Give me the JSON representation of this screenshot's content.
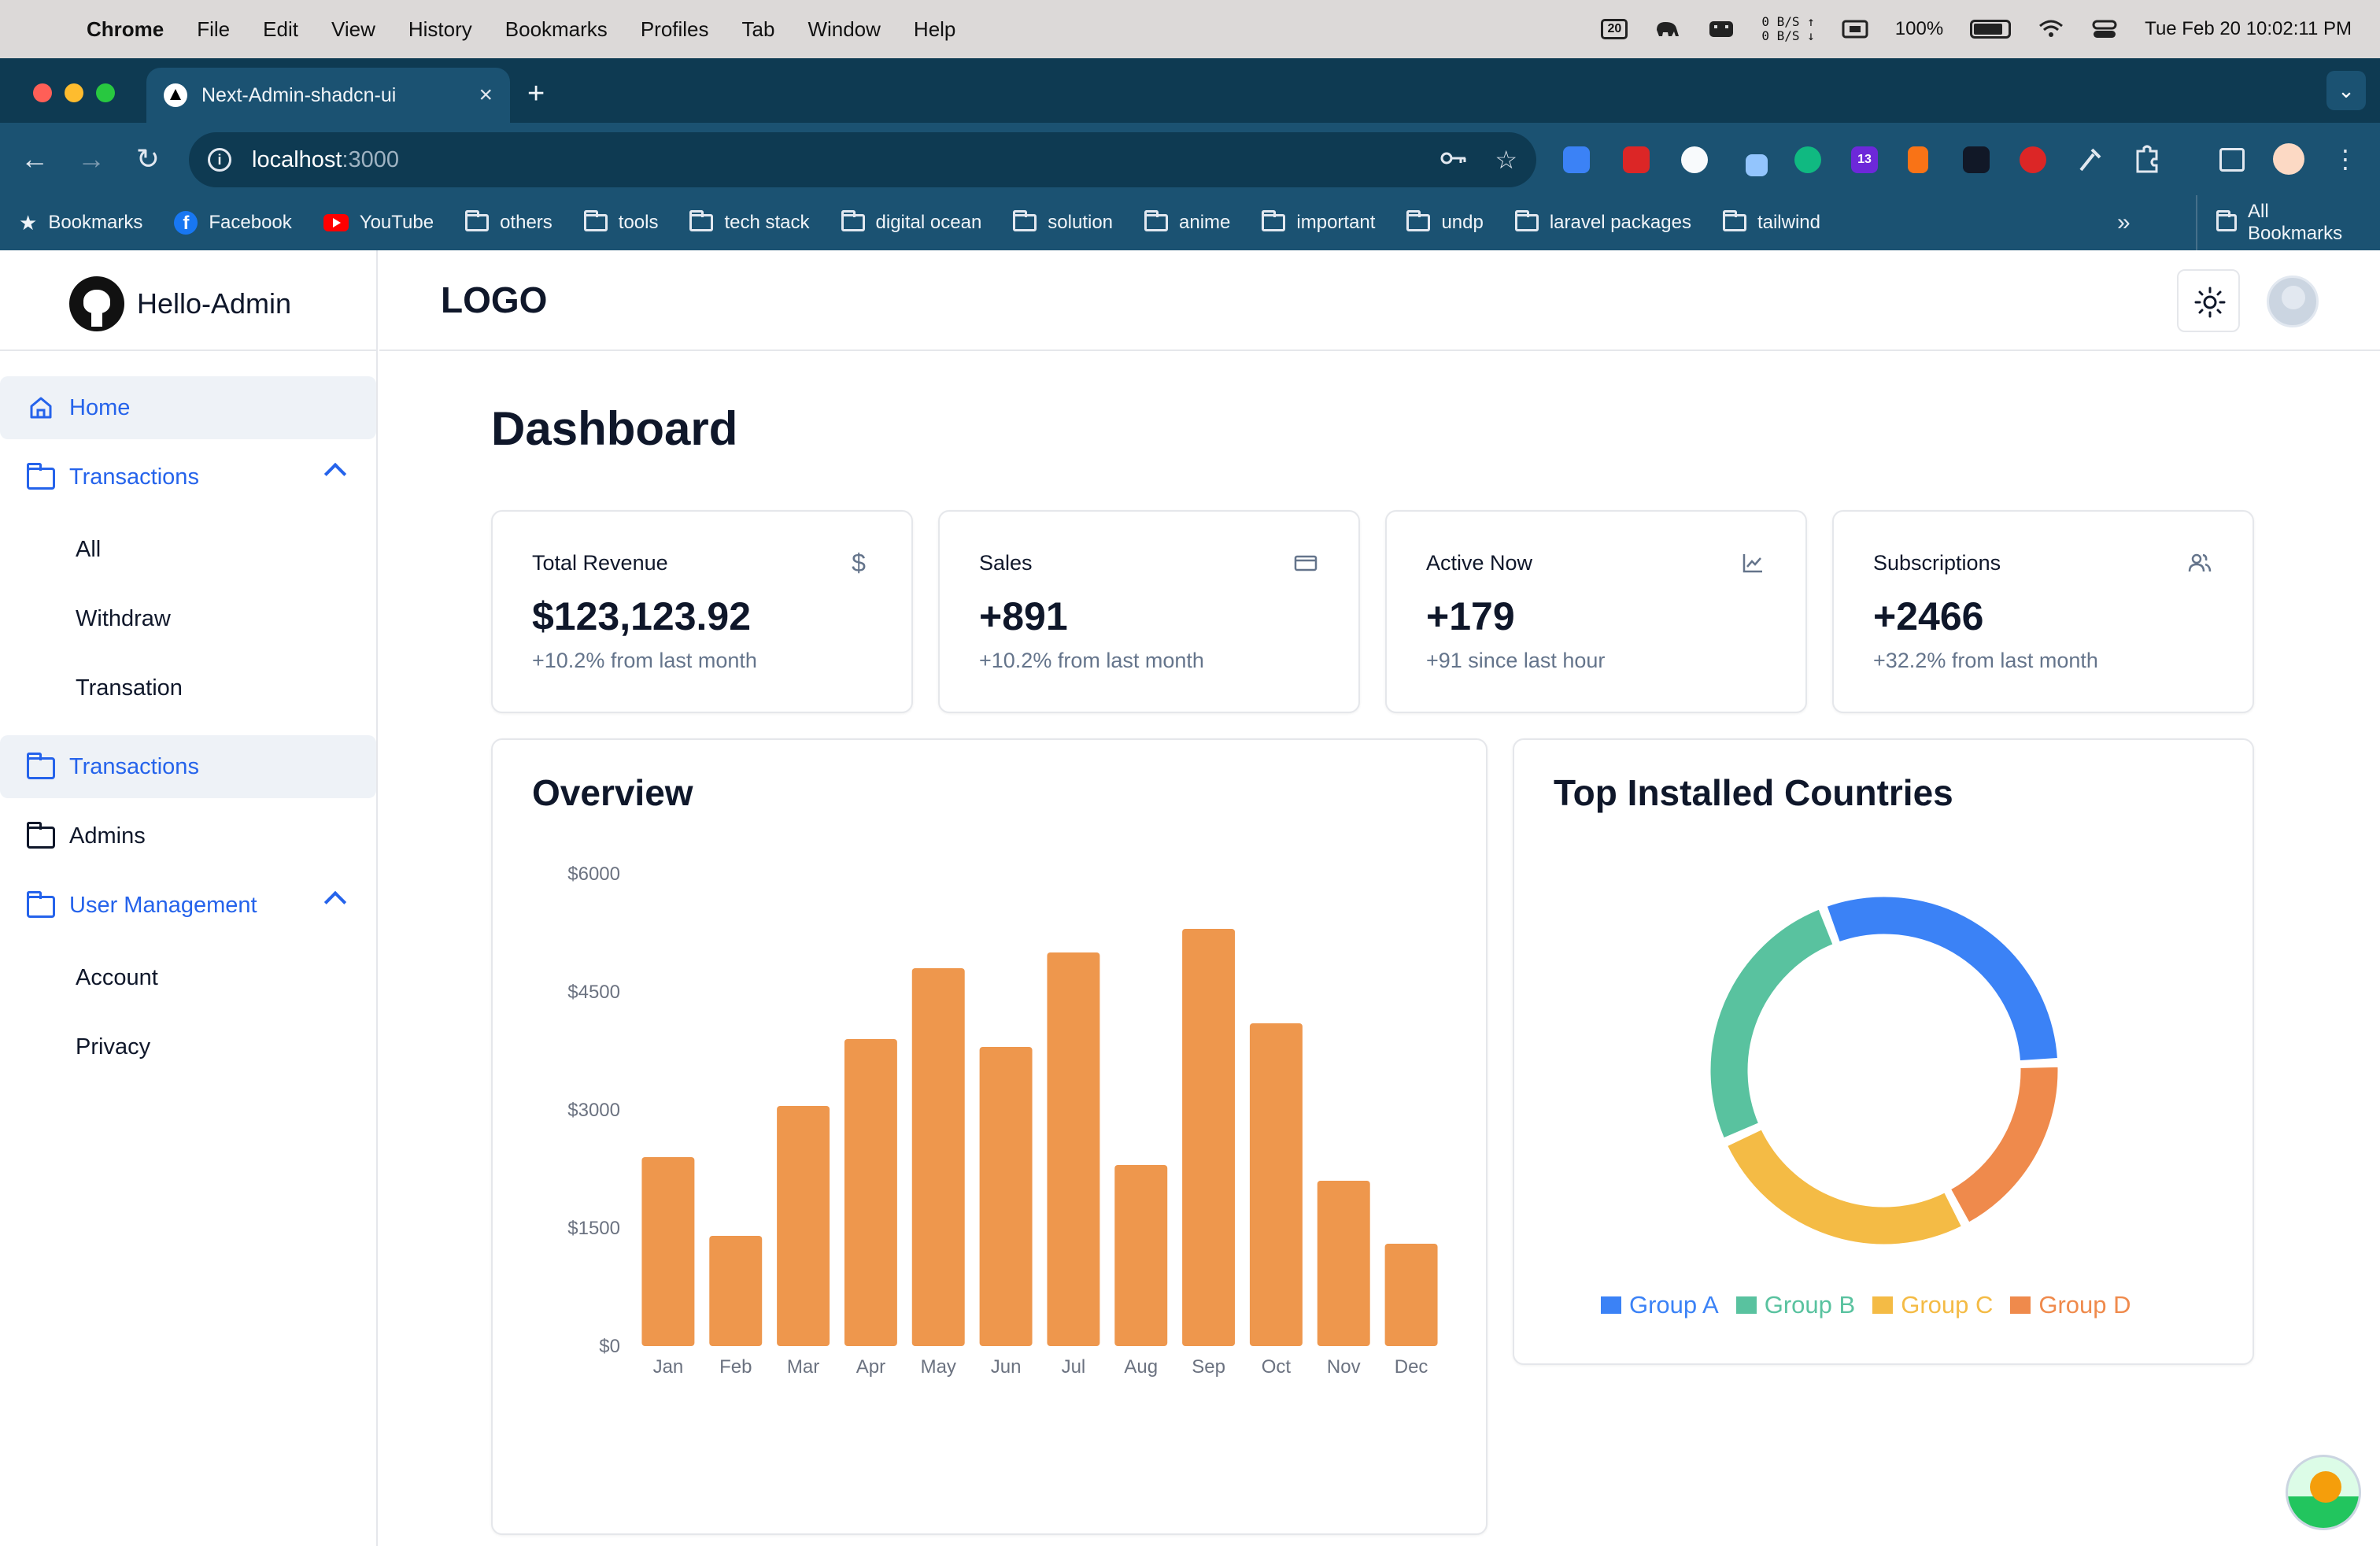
{
  "menubar": {
    "app": "Chrome",
    "items": [
      "File",
      "Edit",
      "View",
      "History",
      "Bookmarks",
      "Profiles",
      "Tab",
      "Window",
      "Help"
    ],
    "calendar_day": "20",
    "net_up": "0 B/S",
    "net_down": "0 B/S",
    "battery": "100%",
    "datetime": "Tue Feb 20  10:02:11 PM"
  },
  "browser": {
    "tab_title": "Next-Admin-shadcn-ui",
    "url_host": "localhost",
    "url_port": ":3000",
    "extension_badge": "13",
    "bookmarks": [
      "Bookmarks",
      "Facebook",
      "YouTube",
      "others",
      "tools",
      "tech stack",
      "digital ocean",
      "solution",
      "anime",
      "important",
      "undp",
      "laravel packages",
      "tailwind"
    ],
    "all_bookmarks": "All Bookmarks"
  },
  "sidebar": {
    "brand": "Hello-Admin",
    "nav": [
      {
        "label": "Home",
        "icon": "home-icon"
      },
      {
        "label": "Transactions",
        "icon": "folder-icon"
      },
      {
        "label": "All"
      },
      {
        "label": "Withdraw"
      },
      {
        "label": "Transation"
      },
      {
        "label": "Transactions",
        "icon": "folder-icon"
      },
      {
        "label": "Admins",
        "icon": "folder-icon"
      },
      {
        "label": "User Management",
        "icon": "folder-icon"
      },
      {
        "label": "Account"
      },
      {
        "label": "Privacy"
      }
    ]
  },
  "header": {
    "logo": "LOGO"
  },
  "main": {
    "title": "Dashboard",
    "stats": [
      {
        "label": "Total Revenue",
        "value": "$123,123.92",
        "delta": "+10.2% from last month",
        "icon": "dollar-icon"
      },
      {
        "label": "Sales",
        "value": "+891",
        "delta": "+10.2% from last month",
        "icon": "credit-card-icon"
      },
      {
        "label": "Active Now",
        "value": "+179",
        "delta": "+91 since last hour",
        "icon": "line-chart-icon"
      },
      {
        "label": "Subscriptions",
        "value": "+2466",
        "delta": "+32.2% from last month",
        "icon": "users-icon"
      }
    ],
    "overview_title": "Overview",
    "countries_title": "Top Installed Countries"
  },
  "colors": {
    "accent": "#2563eb",
    "bar": "#ee974d",
    "group_a": "#3b82f6",
    "group_b": "#59c29f",
    "group_c": "#f4bb45",
    "group_d": "#ef8a4c"
  },
  "chart_data": [
    {
      "type": "bar",
      "title": "Overview",
      "categories": [
        "Jan",
        "Feb",
        "Mar",
        "Apr",
        "May",
        "Jun",
        "Jul",
        "Aug",
        "Sep",
        "Oct",
        "Nov",
        "Dec"
      ],
      "values": [
        2400,
        1400,
        3050,
        3900,
        4800,
        3800,
        5000,
        2300,
        5300,
        4100,
        2100,
        1300
      ],
      "yticks": [
        "$0",
        "$1500",
        "$3000",
        "$4500",
        "$6000"
      ],
      "ylim": [
        0,
        6000
      ],
      "grid": false
    },
    {
      "type": "pie",
      "title": "Top Installed Countries",
      "donut": true,
      "labels": [
        "Group A",
        "Group B",
        "Group C",
        "Group D"
      ],
      "values": [
        30,
        26,
        26,
        18
      ],
      "legend": "bottom"
    }
  ]
}
